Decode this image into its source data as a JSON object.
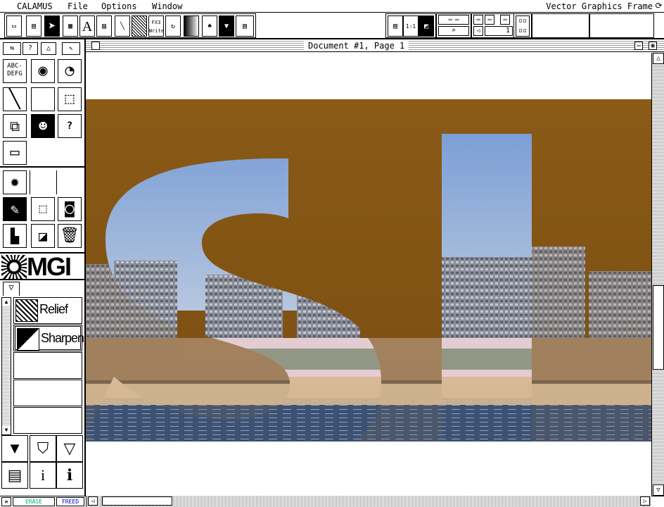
{
  "menubar": {
    "app_label": "CALAMUS",
    "menus": [
      "File",
      "Options",
      "Window"
    ],
    "right_title": "Vector Graphics Frame"
  },
  "toolbar": {
    "write_label": "FX3 Write",
    "zoom_label": "1:1",
    "page_number": "1"
  },
  "left_panel": {
    "tools": {
      "text_sample": "ABC- DEFG",
      "help_label": "?"
    },
    "logo_text": "MGI",
    "filters": [
      {
        "label": "Relief",
        "selected": false
      },
      {
        "label": "Sharpen",
        "selected": true
      },
      {
        "label": "",
        "selected": false
      },
      {
        "label": "",
        "selected": false
      },
      {
        "label": "",
        "selected": false
      }
    ],
    "info_label": "i"
  },
  "document": {
    "title": "Document #1, Page 1",
    "artwork_letters": "SL",
    "colors": {
      "sky": "#7ea4d8",
      "sepia_top": "#8a5a16",
      "sand": "#d6b894",
      "water": "#3a4f6e"
    }
  },
  "statusbar": {
    "erase_label": "ERASE",
    "freed_label": "FREED"
  }
}
